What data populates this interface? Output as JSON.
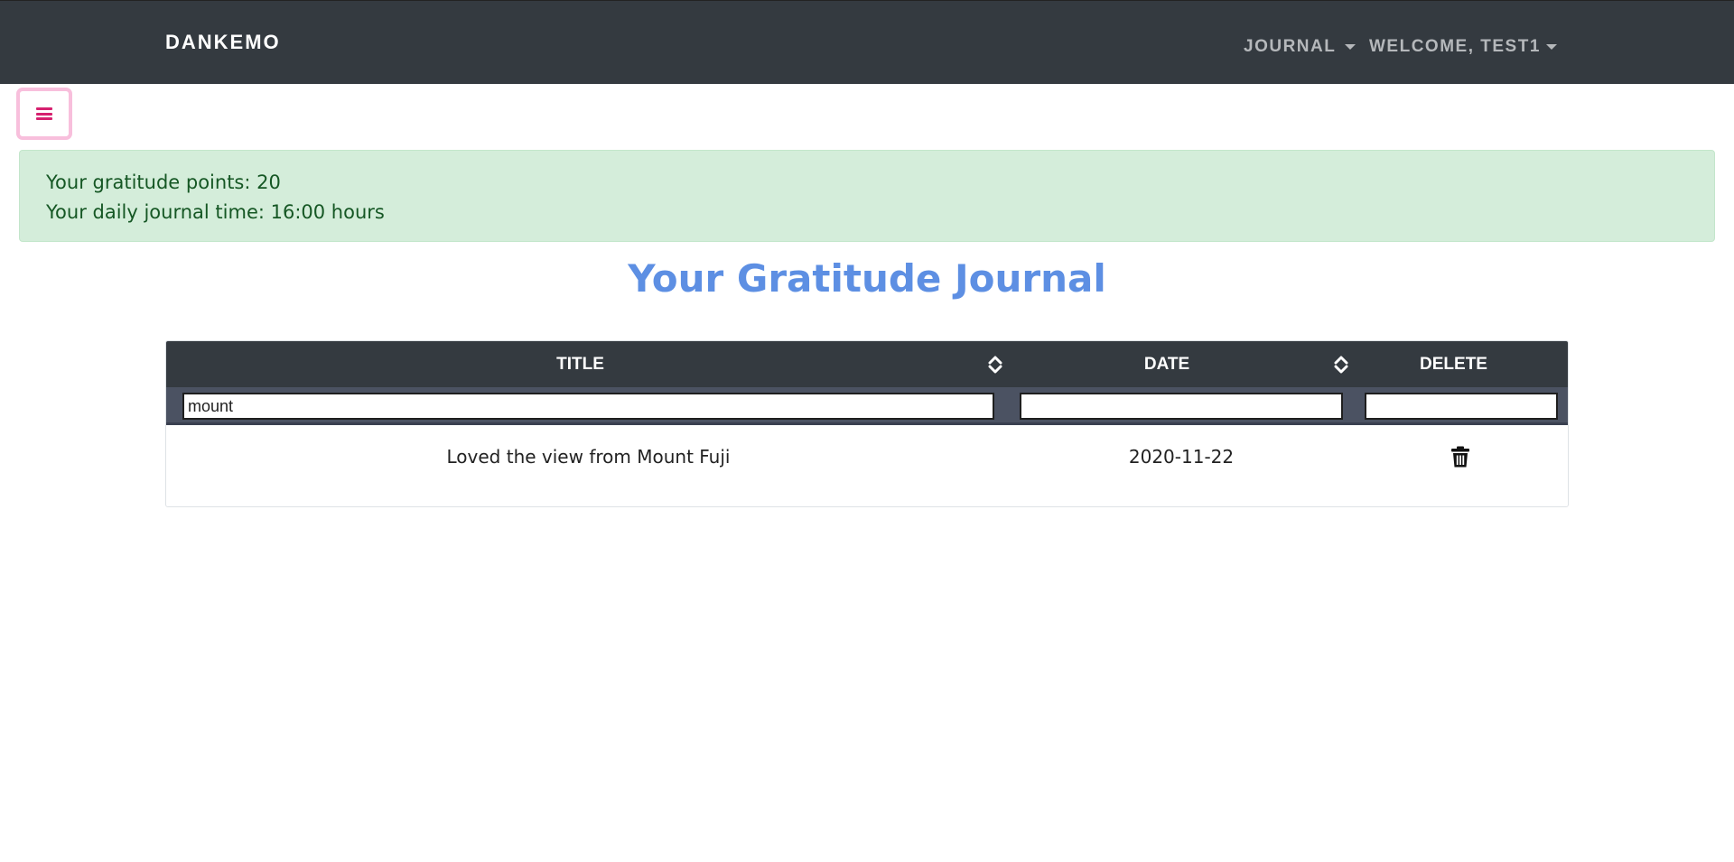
{
  "navbar": {
    "brand": "DANKEMO",
    "journal_menu": "JOURNAL",
    "user_menu": "WELCOME, TEST1"
  },
  "sidebar_toggle": {
    "icon": "menu-icon"
  },
  "alert": {
    "points_line": "Your gratitude points: 20",
    "time_line": "Your daily journal time: 16:00 hours"
  },
  "page": {
    "title": "Your Gratitude Journal"
  },
  "table": {
    "columns": [
      "TITLE",
      "DATE",
      "DELETE"
    ],
    "filters": {
      "title": "mount",
      "date": "",
      "delete": ""
    },
    "rows": [
      {
        "title": "Loved the view from Mount Fuji",
        "date": "2020-11-22",
        "delete_icon": "trash-icon"
      }
    ]
  },
  "colors": {
    "navbar_bg": "#343a40",
    "alert_bg": "#d4edda",
    "alert_text": "#155724",
    "title_color": "#5d8fe3",
    "toggle_accent": "#d6216f"
  }
}
